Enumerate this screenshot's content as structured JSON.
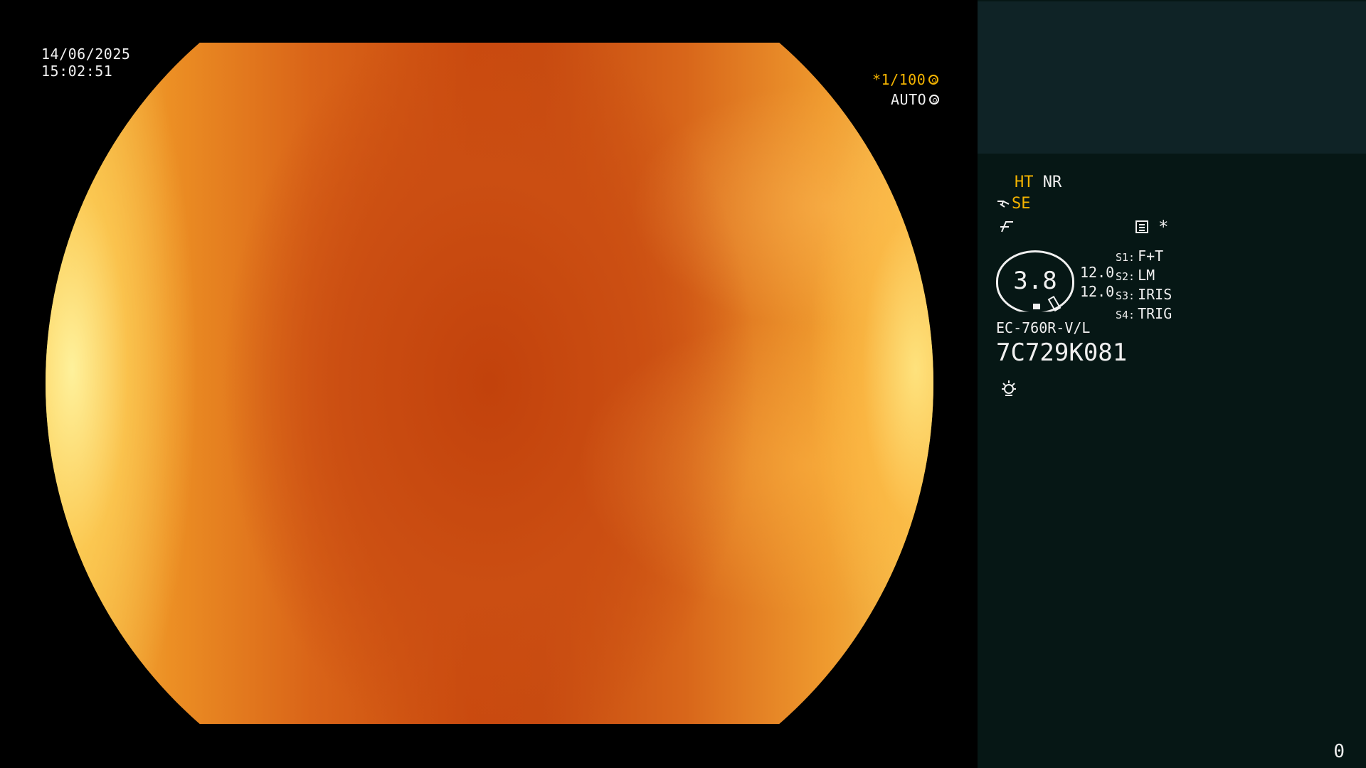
{
  "osd": {
    "date": "14/06/2025",
    "time": "15:02:51",
    "shutter_label": "*1/100",
    "iris_mode_label": "AUTO"
  },
  "panel": {
    "ht_label": "HT",
    "nr_label": "NR",
    "se_label": "SE",
    "enhance_icon": "enhance-icon",
    "gauge_value": "3.8",
    "gauge_side_top": "12.0",
    "gauge_side_bottom": "12.0",
    "switches": [
      {
        "key": "S1:",
        "value": "F+T"
      },
      {
        "key": "S2:",
        "value": "LM"
      },
      {
        "key": "S3:",
        "value": "IRIS"
      },
      {
        "key": "S4:",
        "value": "TRIG"
      }
    ],
    "scope_model": "EC-760R-V/L",
    "scope_serial": "7C729K081",
    "counter": "0"
  },
  "colors": {
    "accent_amber": "#f5b400",
    "panel_bg": "#061715",
    "patient_box_bg": "#0f2326",
    "text": "#f0f0f0"
  },
  "icons": [
    "shutter-icon",
    "iris-icon",
    "scope-tip-icon",
    "enhance-icon",
    "menu-icon",
    "asterisk-icon",
    "light-icon"
  ]
}
